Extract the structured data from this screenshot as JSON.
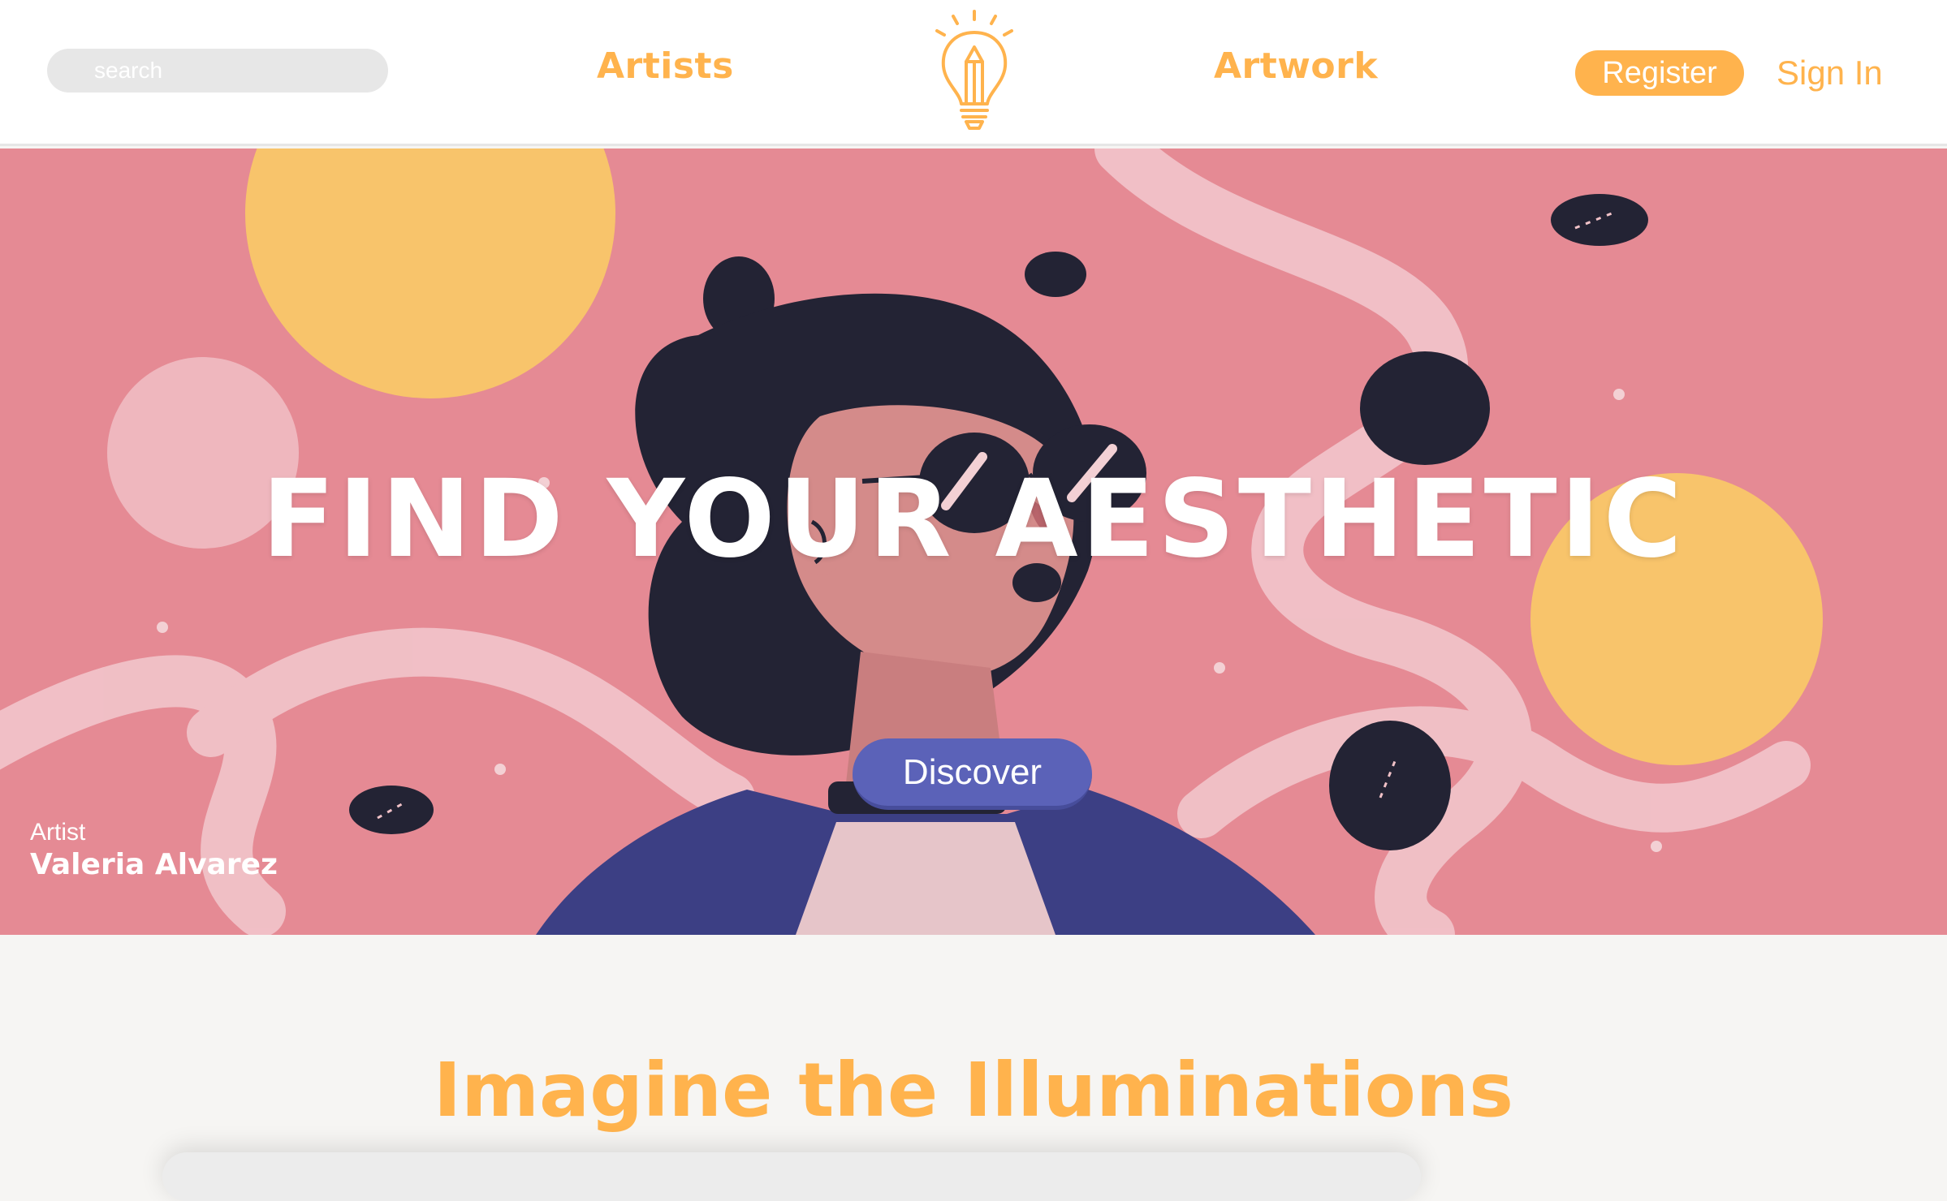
{
  "header": {
    "search_placeholder": "search",
    "nav": [
      {
        "label": "Artists"
      },
      {
        "label": "Artwork"
      }
    ],
    "register_label": "Register",
    "signin_label": "Sign In",
    "logo_icon": "lightbulb-pencil-icon"
  },
  "hero": {
    "title": "FIND YOUR AESTHETIC",
    "cta_label": "Discover",
    "credit": {
      "label": "Artist",
      "name": "Valeria Alvarez"
    }
  },
  "section": {
    "title": "Imagine the Illuminations"
  },
  "colors": {
    "accent": "#ffb34d",
    "hero_bg": "#e58a94",
    "cta": "#5b62b8",
    "page_bg": "#f6f5f3"
  }
}
